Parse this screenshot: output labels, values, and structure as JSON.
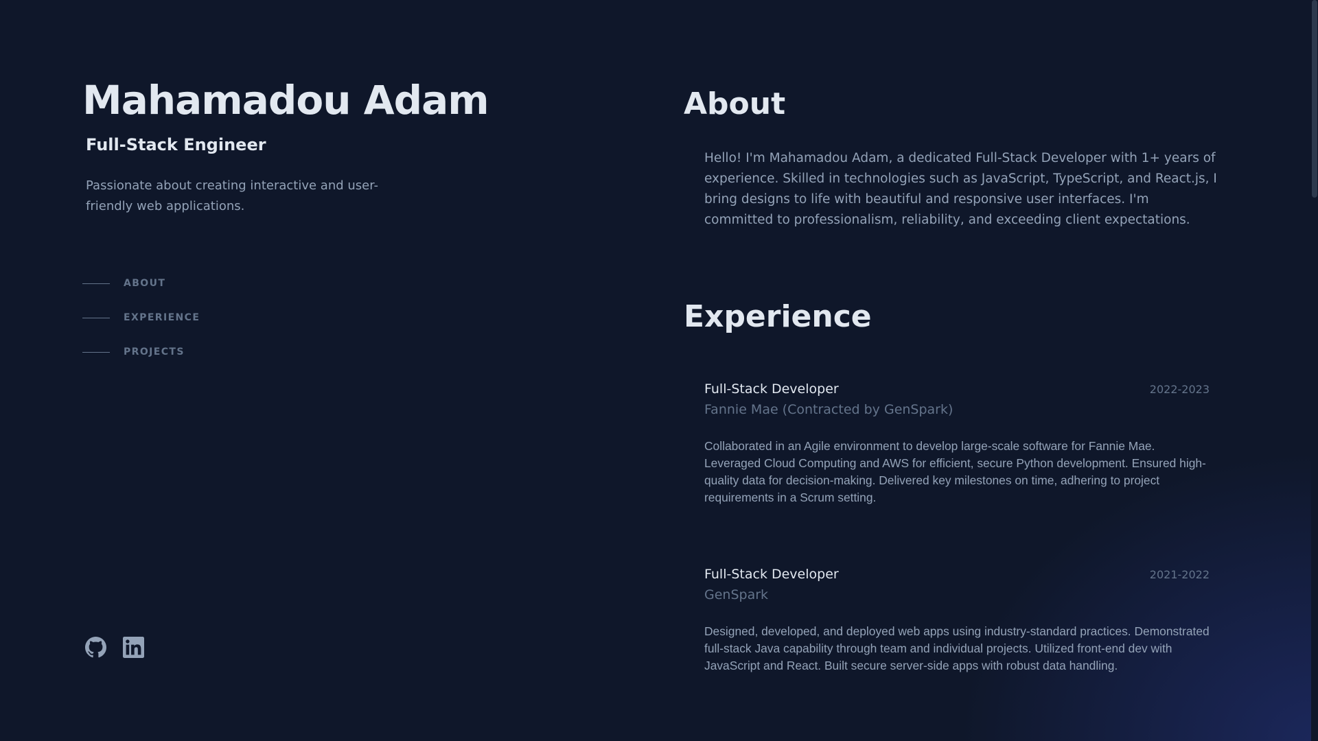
{
  "header": {
    "name": "Mahamadou Adam",
    "role": "Full-Stack Engineer",
    "tagline": "Passionate about creating interactive and user-friendly web applications."
  },
  "nav": {
    "items": [
      {
        "label": "ABOUT"
      },
      {
        "label": "EXPERIENCE"
      },
      {
        "label": "PROJECTS"
      }
    ]
  },
  "socials": {
    "icons": [
      "github-icon",
      "linkedin-icon"
    ]
  },
  "about": {
    "title": "About",
    "text": "Hello! I'm Mahamadou Adam, a dedicated Full-Stack Developer with 1+ years of experience. Skilled in technologies such as JavaScript, TypeScript, and React.js, I bring designs to life with beautiful and responsive user interfaces. I'm committed to professionalism, reliability, and exceeding client expectations."
  },
  "experience": {
    "title": "Experience",
    "jobs": [
      {
        "title": "Full-Stack Developer",
        "company": "Fannie Mae (Contracted by GenSpark)",
        "dates": "2022-2023",
        "description": "Collaborated in an Agile environment to develop large-scale software for Fannie Mae. Leveraged Cloud Computing and AWS for efficient, secure Python development. Ensured high-quality data for decision-making. Delivered key milestones on time, adhering to project requirements in a Scrum setting."
      },
      {
        "title": "Full-Stack Developer",
        "company": "GenSpark",
        "dates": "2021-2022",
        "description": "Designed, developed, and deployed web apps using industry-standard practices. Demonstrated full-stack Java capability through team and individual projects. Utilized front-end dev with JavaScript and React. Built secure server-side apps with robust data handling."
      }
    ]
  },
  "colors": {
    "background": "#0f172a",
    "heading": "#e2e8f0",
    "body": "#94a3b8",
    "muted": "#64748b"
  }
}
